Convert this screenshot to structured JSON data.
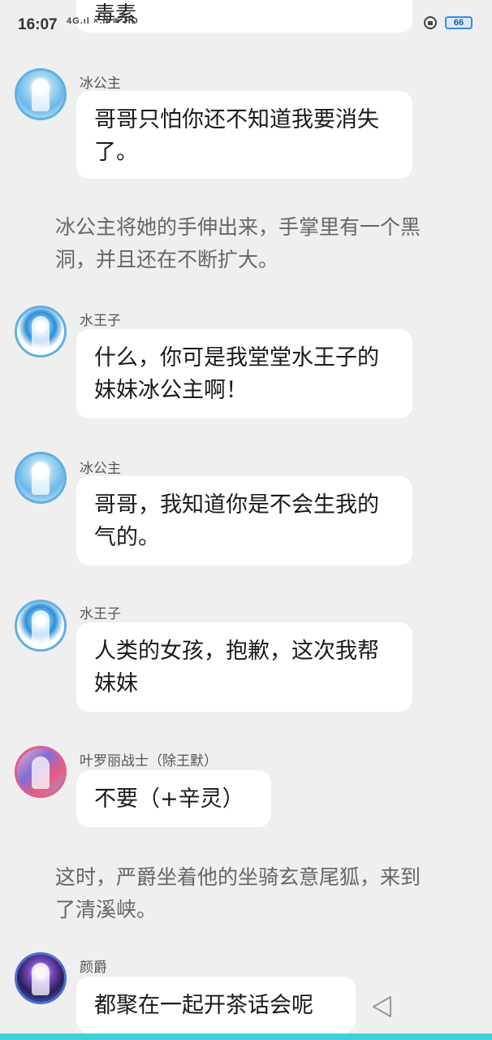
{
  "status": {
    "time": "16:07",
    "signal": "4G.ıl ×.ıl ≋ HD",
    "battery": "66"
  },
  "top_partial": "毒素",
  "chat": [
    {
      "kind": "msg",
      "name": "冰公主",
      "text": "哥哥只怕你还不知道我要消失了。"
    },
    {
      "kind": "narr",
      "text": "冰公主将她的手伸出来，手掌里有一个黑洞，并且还在不断扩大。"
    },
    {
      "kind": "msg",
      "name": "水王子",
      "text": "什么，你可是我堂堂水王子的妹妹冰公主啊！"
    },
    {
      "kind": "msg",
      "name": "冰公主",
      "text": "哥哥，我知道你是不会生我的气的。"
    },
    {
      "kind": "msg",
      "name": "水王子",
      "text": "人类的女孩，抱歉，这次我帮妹妹"
    },
    {
      "kind": "msg",
      "name": "叶罗丽战士（除王默）",
      "text": "不要（+辛灵）"
    },
    {
      "kind": "narr",
      "text": "这时，严爵坐着他的坐骑玄意尾狐，来到了清溪峡。"
    },
    {
      "kind": "msg",
      "name": "颜爵",
      "text": "都聚在一起开茶话会呢"
    }
  ],
  "icons": {
    "lock": "lock-icon",
    "send": "send-icon"
  },
  "colors": {
    "accent": "#3fd0d8",
    "battery": "#3a8ed8"
  }
}
